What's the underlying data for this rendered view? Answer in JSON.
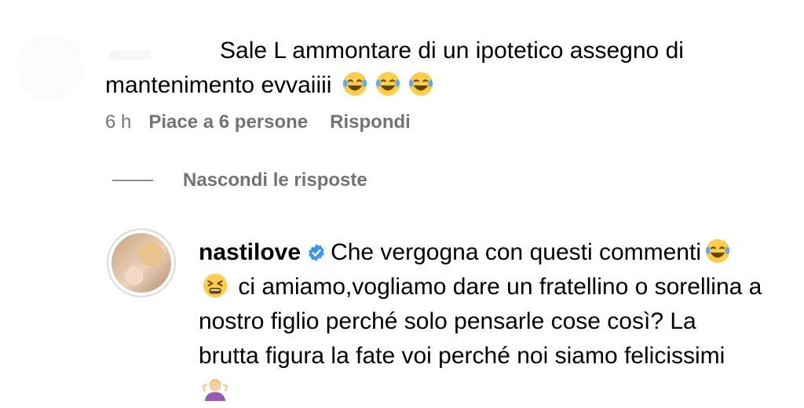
{
  "comment": {
    "text_line1": "Sale L ammontare di un ipotetico assegno di",
    "text_line2": "mantenimento evvaiiii",
    "emojis": [
      "laughing-tears-emoji",
      "laughing-tears-emoji",
      "laughing-tears-emoji"
    ],
    "time": "6 h",
    "likes": "Piace a 6 persone",
    "reply": "Rispondi"
  },
  "replies_toggle": {
    "label": "Nascondi le risposte"
  },
  "reply": {
    "username": "nastilove",
    "verified_icon": "verified-badge-icon",
    "line1": "Che vergogna con questi commenti",
    "line2": "ci amiamo,vogliamo dare un fratellino o sorellina a",
    "line3": "nostro figlio perché solo pensarle cose così? La",
    "line4": "brutta figura la fate voi perché noi siamo felicissimi",
    "emojis": [
      "laughing-tears-emoji",
      "tired-face-emoji",
      "woman-shrugging-emoji"
    ]
  },
  "colors": {
    "secondary_text": "#737373",
    "verified_blue": "#3897f0",
    "emoji_yellow": "#ffcc4d"
  }
}
